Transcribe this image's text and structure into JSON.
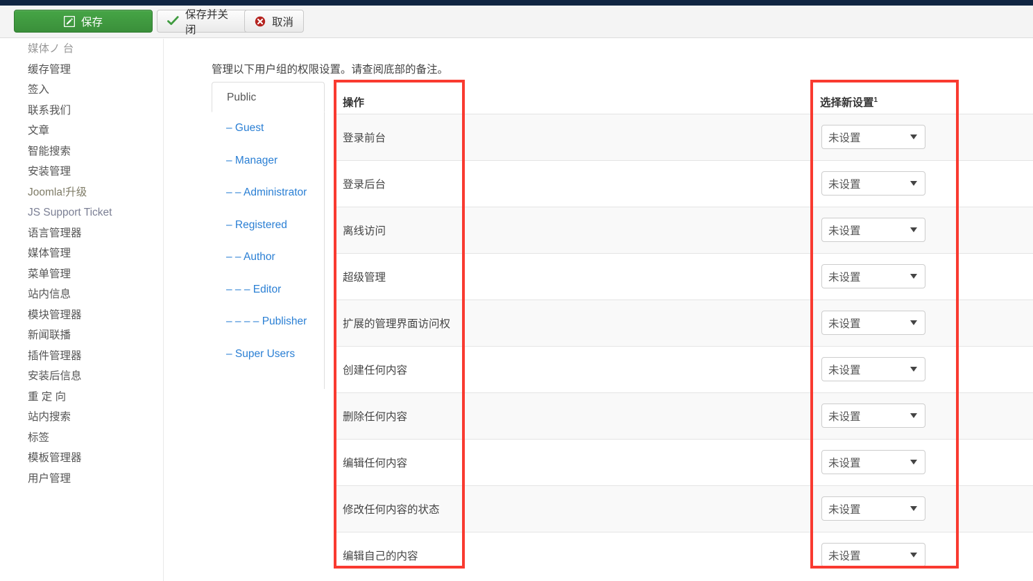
{
  "topbar": {
    "color": "#102542"
  },
  "toolbar": {
    "buttons": [
      {
        "name": "save",
        "label": "保存",
        "icon": "pencil-square-icon",
        "style": "primary"
      },
      {
        "name": "save-close",
        "label": "保存并关闭",
        "icon": "check-icon",
        "style": "default"
      },
      {
        "name": "cancel",
        "label": "取消",
        "icon": "close-circle-icon",
        "style": "default"
      }
    ]
  },
  "sidebar": {
    "items": [
      {
        "label": "媒体ノ 台",
        "state": "clipped"
      },
      {
        "label": "缓存管理",
        "state": "normal"
      },
      {
        "label": "签入",
        "state": "normal"
      },
      {
        "label": "联系我们",
        "state": "normal"
      },
      {
        "label": "文章",
        "state": "normal"
      },
      {
        "label": "智能搜索",
        "state": "normal"
      },
      {
        "label": "安装管理",
        "state": "normal"
      },
      {
        "label": "Joomla!升级",
        "state": "link"
      },
      {
        "label": "JS Support Ticket",
        "state": "link2"
      },
      {
        "label": "语言管理器",
        "state": "normal"
      },
      {
        "label": "媒体管理",
        "state": "normal"
      },
      {
        "label": "菜单管理",
        "state": "normal"
      },
      {
        "label": "站内信息",
        "state": "normal"
      },
      {
        "label": "模块管理器",
        "state": "normal"
      },
      {
        "label": "新闻联播",
        "state": "normal"
      },
      {
        "label": "插件管理器",
        "state": "normal"
      },
      {
        "label": "安装后信息",
        "state": "normal"
      },
      {
        "label": "重 定 向",
        "state": "normal"
      },
      {
        "label": "站内搜索",
        "state": "normal"
      },
      {
        "label": "标签",
        "state": "normal"
      },
      {
        "label": "模板管理器",
        "state": "normal"
      },
      {
        "label": "用户管理",
        "state": "normal"
      }
    ]
  },
  "main": {
    "description": "管理以下用户组的权限设置。请查阅底部的备注。",
    "groups": {
      "active": "Public",
      "items": [
        {
          "label": "– Guest",
          "level": 1
        },
        {
          "label": "– Manager",
          "level": 1
        },
        {
          "label": "– – Administrator",
          "level": 2
        },
        {
          "label": "– Registered",
          "level": 1
        },
        {
          "label": "– – Author",
          "level": 2
        },
        {
          "label": "– – – Editor",
          "level": 3
        },
        {
          "label": "– – – – Publisher",
          "level": 4
        },
        {
          "label": "– Super Users",
          "level": 1
        }
      ]
    },
    "table": {
      "headers": {
        "action": "操作",
        "middle": "",
        "setting": "选择新设置",
        "setting_superscript": "1"
      },
      "rows": [
        {
          "action": "登录前台",
          "setting": "未设置"
        },
        {
          "action": "登录后台",
          "setting": "未设置"
        },
        {
          "action": "离线访问",
          "setting": "未设置"
        },
        {
          "action": "超级管理",
          "setting": "未设置"
        },
        {
          "action": "扩展的管理界面访问权",
          "setting": "未设置"
        },
        {
          "action": "创建任何内容",
          "setting": "未设置"
        },
        {
          "action": "删除任何内容",
          "setting": "未设置"
        },
        {
          "action": "编辑任何内容",
          "setting": "未设置"
        },
        {
          "action": "修改任何内容的状态",
          "setting": "未设置"
        },
        {
          "action": "编辑自己的内容",
          "setting": "未设置"
        }
      ]
    }
  },
  "highlights": {
    "action_column": {
      "color": "#f93a30"
    },
    "setting_column": {
      "color": "#f93a30"
    }
  }
}
